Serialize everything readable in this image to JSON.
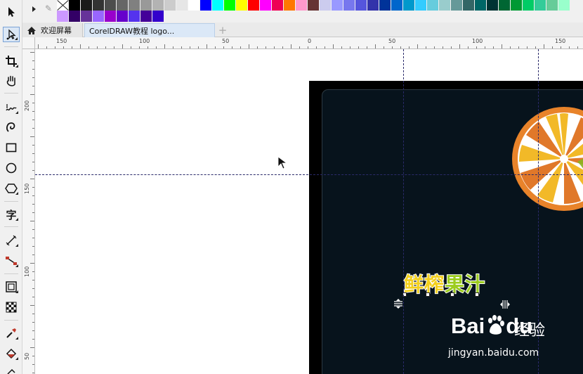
{
  "palette": {
    "row1": [
      "none",
      "#000000",
      "#1a1a1a",
      "#333333",
      "#4d4d4d",
      "#666666",
      "#808080",
      "#999999",
      "#b3b3b3",
      "#cccccc",
      "#e6e6e6",
      "#ffffff",
      "#0000ff",
      "#00ffff",
      "#00ff00",
      "#ffff00",
      "#ff0000",
      "#ff00ff",
      "#ee0055",
      "#ff7700",
      "#ff99cc",
      "#663333",
      "#ccccee",
      "#9999ff",
      "#7777ee",
      "#5555dd",
      "#3333aa",
      "#003399",
      "#0066cc",
      "#0099cc",
      "#33ccff",
      "#66ccdd",
      "#99cccc",
      "#669999",
      "#336666",
      "#006666",
      "#003333",
      "#006633",
      "#009933",
      "#00cc66",
      "#33cc99",
      "#66cc99",
      "#99ffcc"
    ],
    "row2": [
      "#cc99ff",
      "#330066",
      "#663399",
      "#9966ff",
      "#9900cc",
      "#6600cc",
      "#5533ee",
      "#440099",
      "#3300cc"
    ]
  },
  "tabs": {
    "welcome": "欢迎屏幕",
    "document": "CorelDRAW教程 logo...",
    "add": "+"
  },
  "ruler": {
    "h_labels": [
      "150",
      "100",
      "50",
      "0",
      "50",
      "100",
      "150"
    ],
    "v_labels": [
      "200",
      "150",
      "100",
      "50"
    ]
  },
  "artwork": {
    "title_part1": "鲜榨",
    "title_part2": "果汁"
  },
  "watermark": {
    "brand_bai": "Bai",
    "brand_du": "du",
    "brand_cn": "经验",
    "url": "jingyan.baidu.com"
  }
}
